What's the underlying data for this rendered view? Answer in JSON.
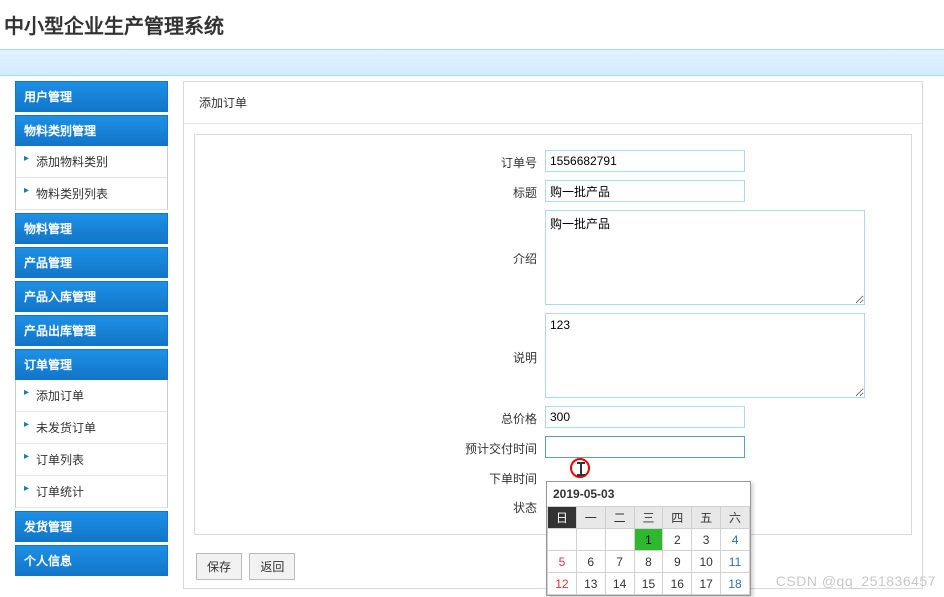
{
  "page": {
    "title": "中小型企业生产管理系统"
  },
  "sidebar": {
    "groups": [
      {
        "label": "用户管理",
        "items": []
      },
      {
        "label": "物料类别管理",
        "items": [
          {
            "label": "添加物料类别"
          },
          {
            "label": "物料类别列表"
          }
        ]
      },
      {
        "label": "物料管理",
        "items": []
      },
      {
        "label": "产品管理",
        "items": []
      },
      {
        "label": "产品入库管理",
        "items": []
      },
      {
        "label": "产品出库管理",
        "items": []
      },
      {
        "label": "订单管理",
        "items": [
          {
            "label": "添加订单"
          },
          {
            "label": "未发货订单"
          },
          {
            "label": "订单列表"
          },
          {
            "label": "订单统计"
          }
        ]
      },
      {
        "label": "发货管理",
        "items": []
      },
      {
        "label": "个人信息",
        "items": []
      }
    ]
  },
  "content": {
    "header": "添加订单"
  },
  "form": {
    "order_no": {
      "label": "订单号",
      "value": "1556682791"
    },
    "title": {
      "label": "标题",
      "value": "购一批产品"
    },
    "intro": {
      "label": "介绍",
      "value": "购一批产品"
    },
    "desc": {
      "label": "说明",
      "value": "123"
    },
    "price": {
      "label": "总价格",
      "value": "300"
    },
    "delivery": {
      "label": "预计交付时间",
      "value": ""
    },
    "order_time": {
      "label": "下单时间"
    },
    "status": {
      "label": "状态"
    }
  },
  "buttons": {
    "save": "保存",
    "back": "返回"
  },
  "datepicker": {
    "header": "2019-05-03",
    "weekdays": [
      "日",
      "一",
      "二",
      "三",
      "四",
      "五",
      "六"
    ],
    "rows": [
      [
        "",
        "",
        "",
        "",
        "1",
        "2",
        "3",
        "4"
      ],
      [
        "5",
        "6",
        "7",
        "8",
        "9",
        "10",
        "11"
      ],
      [
        "12",
        "13",
        "14",
        "15",
        "16",
        "17",
        "18"
      ]
    ],
    "today": "1"
  },
  "watermark": "CSDN @qq_251836457"
}
